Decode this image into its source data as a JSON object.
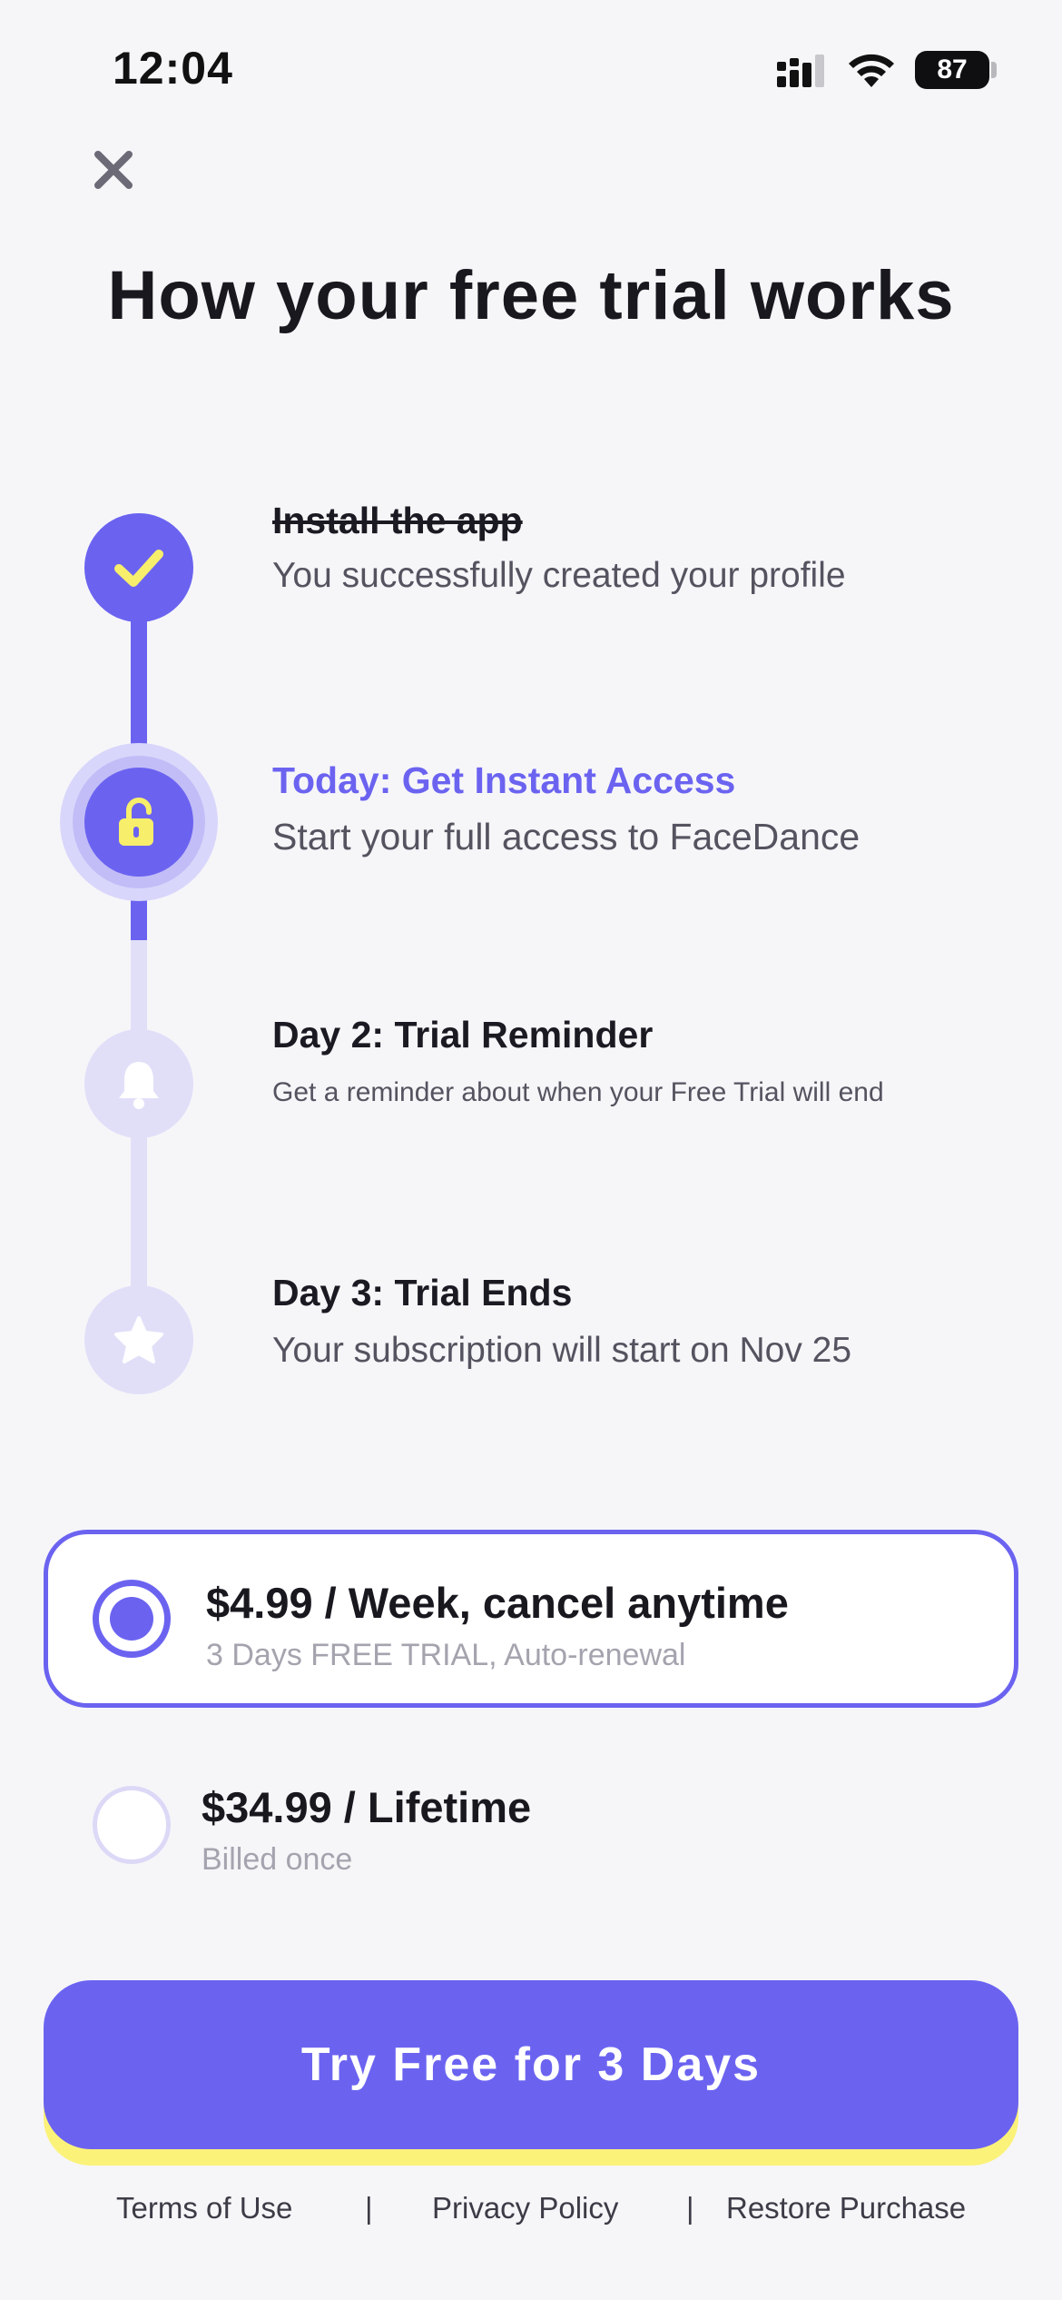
{
  "status_bar": {
    "time": "12:04",
    "battery": "87"
  },
  "page_title": "How your free trial works",
  "steps": [
    {
      "title": "Install the app",
      "description": "You successfully created your profile",
      "icon": "check-icon",
      "state": "done"
    },
    {
      "title": "Today: Get Instant Access",
      "description": "Start your full access to FaceDance",
      "icon": "unlock-icon",
      "state": "current"
    },
    {
      "title": "Day 2: Trial Reminder",
      "description": "Get a reminder about when your Free Trial will end",
      "icon": "bell-icon",
      "state": "upcoming"
    },
    {
      "title": "Day 3: Trial Ends",
      "description": "Your subscription will start on Nov 25",
      "icon": "star-icon",
      "state": "upcoming"
    }
  ],
  "plans": [
    {
      "title": "$4.99 / Week, cancel anytime",
      "subtitle": "3 Days FREE TRIAL, Auto-renewal",
      "selected": true
    },
    {
      "title": "$34.99 / Lifetime",
      "subtitle": "Billed once",
      "selected": false
    }
  ],
  "cta_label": "Try Free for 3 Days",
  "footer": {
    "terms": "Terms of Use",
    "separator": "|",
    "privacy": "Privacy Policy",
    "restore": "Restore Purchase"
  },
  "colors": {
    "accent": "#6b63f0",
    "accent_light": "#e1dff8",
    "highlight_yellow": "#fbf27a",
    "background": "#f6f6f9"
  }
}
